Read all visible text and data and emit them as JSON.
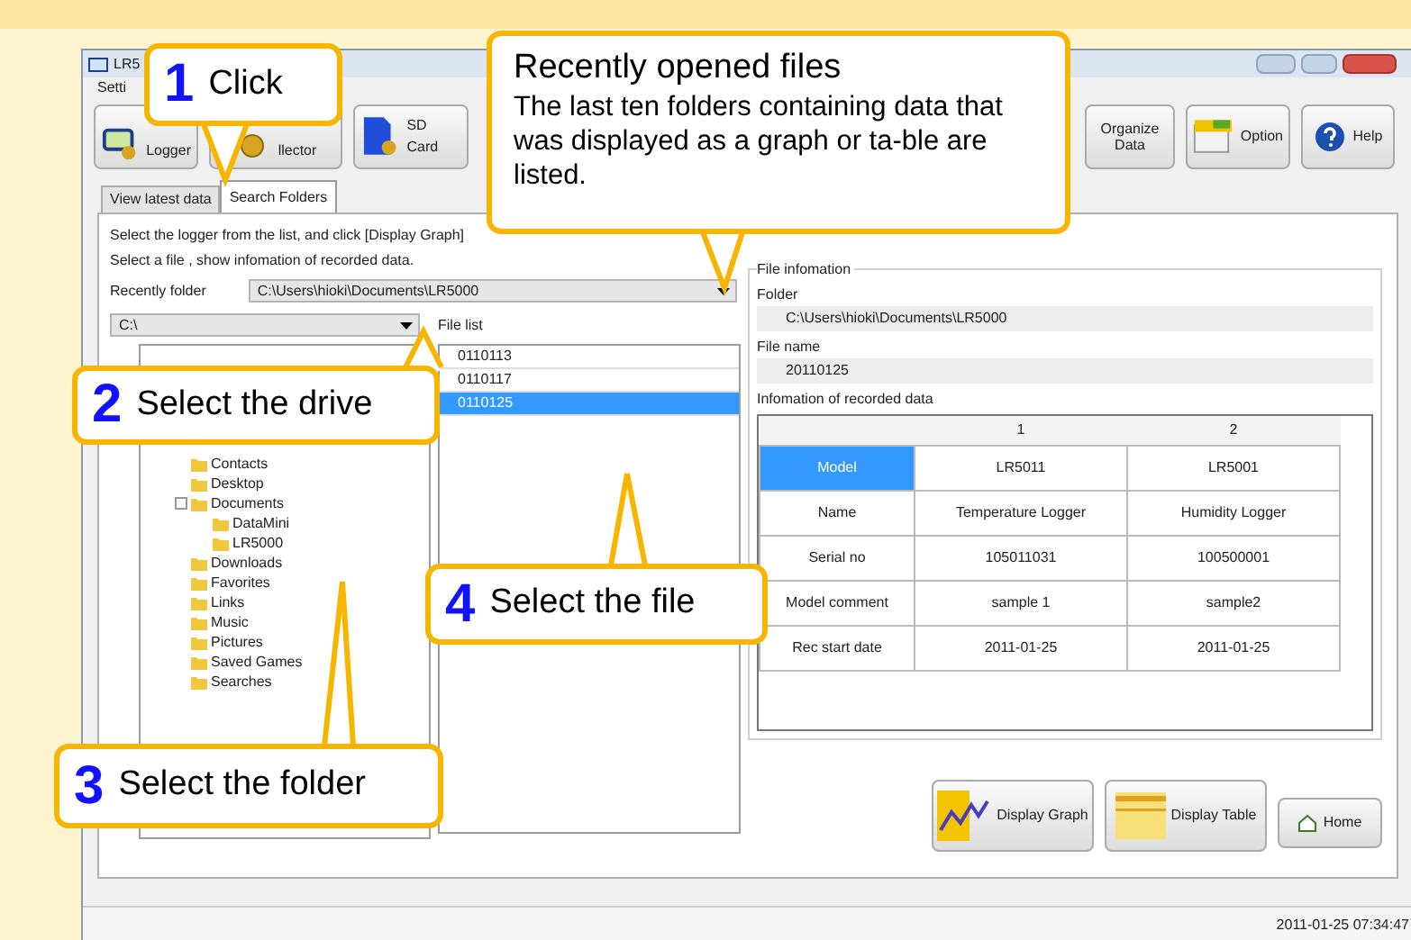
{
  "window": {
    "title": "LR5",
    "menu": [
      "Setti"
    ]
  },
  "toolbar": [
    {
      "label": "Logger",
      "kind": "logger"
    },
    {
      "label": "llector",
      "kind": "collector"
    },
    {
      "label": "SD Card",
      "kind": "sdcard"
    },
    {
      "label": "Organize Data",
      "kind": "text"
    },
    {
      "label": "Option",
      "kind": "option"
    },
    {
      "label": "Help",
      "kind": "help"
    }
  ],
  "tabs": [
    {
      "label": "View latest data",
      "selected": false
    },
    {
      "label": "Search Folders",
      "selected": true
    }
  ],
  "instructions": [
    "Select the logger from the list, and click [Display Graph]",
    "Select a file , show infomation of recorded data."
  ],
  "recent_folder": {
    "label": "Recently folder",
    "value": "C:\\Users\\hioki\\Documents\\LR5000"
  },
  "drive": {
    "value": "C:\\"
  },
  "folder_tree": [
    {
      "label": "Contacts"
    },
    {
      "label": "Desktop"
    },
    {
      "label": "Documents",
      "children": [
        {
          "label": "DataMini"
        },
        {
          "label": "LR5000"
        }
      ]
    },
    {
      "label": "Downloads"
    },
    {
      "label": "Favorites"
    },
    {
      "label": "Links"
    },
    {
      "label": "Music"
    },
    {
      "label": "Pictures"
    },
    {
      "label": "Saved Games"
    },
    {
      "label": "Searches"
    }
  ],
  "file_list": {
    "label": "File list",
    "items": [
      {
        "label": "0110113",
        "selected": false
      },
      {
        "label": "0110117",
        "selected": false
      },
      {
        "label": "0110125",
        "selected": true
      }
    ]
  },
  "file_info": {
    "title": "File infomation",
    "folder_label": "Folder",
    "folder": "C:\\Users\\hioki\\Documents\\LR5000",
    "file_name_label": "File name",
    "file_name": "20110125",
    "records_label": "Infomation of recorded data",
    "table": {
      "columns": [
        "1",
        "2"
      ],
      "rows": [
        {
          "header": "Model",
          "selected": true,
          "cells": [
            "LR5011",
            "LR5001"
          ]
        },
        {
          "header": "Name",
          "selected": false,
          "cells": [
            "Temperature Logger",
            "Humidity Logger"
          ]
        },
        {
          "header": "Serial no",
          "selected": false,
          "cells": [
            "105011031",
            "100500001"
          ]
        },
        {
          "header": "Model comment",
          "selected": false,
          "cells": [
            "sample 1",
            "sample2"
          ]
        },
        {
          "header": "Rec start date",
          "selected": false,
          "cells": [
            "2011-01-25",
            "2011-01-25"
          ]
        }
      ]
    }
  },
  "buttons": [
    {
      "label": "Display Graph",
      "kind": "graph"
    },
    {
      "label": "Display Table",
      "kind": "table"
    },
    {
      "label": "Home",
      "kind": "home"
    }
  ],
  "status_bar": {
    "time": "2011-01-25 07:34:47"
  },
  "callouts": [
    {
      "kind": "step",
      "number": "1",
      "text": "Click"
    },
    {
      "kind": "note",
      "title": "Recently opened files",
      "text": "The last ten folders containing data that was displayed as a graph or ta-ble are listed."
    },
    {
      "kind": "step",
      "number": "2",
      "text": "Select the drive"
    },
    {
      "kind": "step",
      "number": "4",
      "text": "Select the file"
    },
    {
      "kind": "step",
      "number": "3",
      "text": "Select the folder"
    }
  ]
}
